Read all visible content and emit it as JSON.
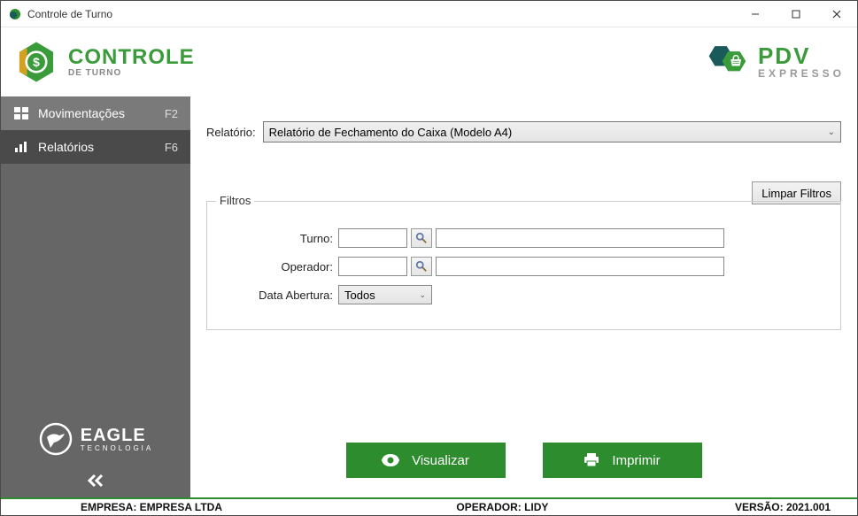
{
  "window": {
    "title": "Controle de Turno"
  },
  "header": {
    "left_logo": {
      "line1": "CONTROLE",
      "line2": "DE TURNO"
    },
    "right_logo": {
      "line1": "PDV",
      "line2": "EXPRESSO"
    }
  },
  "sidebar": {
    "items": [
      {
        "label": "Movimentações",
        "key": "F2"
      },
      {
        "label": "Relatórios",
        "key": "F6"
      }
    ],
    "eagle": {
      "line1": "EAGLE",
      "line2": "TECNOLOGIA"
    }
  },
  "main": {
    "report_label": "Relatório:",
    "report_value": "Relatório de Fechamento do Caixa (Modelo A4)",
    "clear_filters": "Limpar Filtros",
    "fieldset_legend": "Filtros",
    "turno_label": "Turno:",
    "turno_code": "",
    "turno_name": "",
    "operador_label": "Operador:",
    "operador_code": "",
    "operador_name": "",
    "data_abertura_label": "Data Abertura:",
    "data_abertura_value": "Todos",
    "visualizar": "Visualizar",
    "imprimir": "Imprimir"
  },
  "statusbar": {
    "empresa": "EMPRESA: EMPRESA LTDA",
    "operador": "OPERADOR: LIDY",
    "versao": "VERSÃO: 2021.001"
  }
}
